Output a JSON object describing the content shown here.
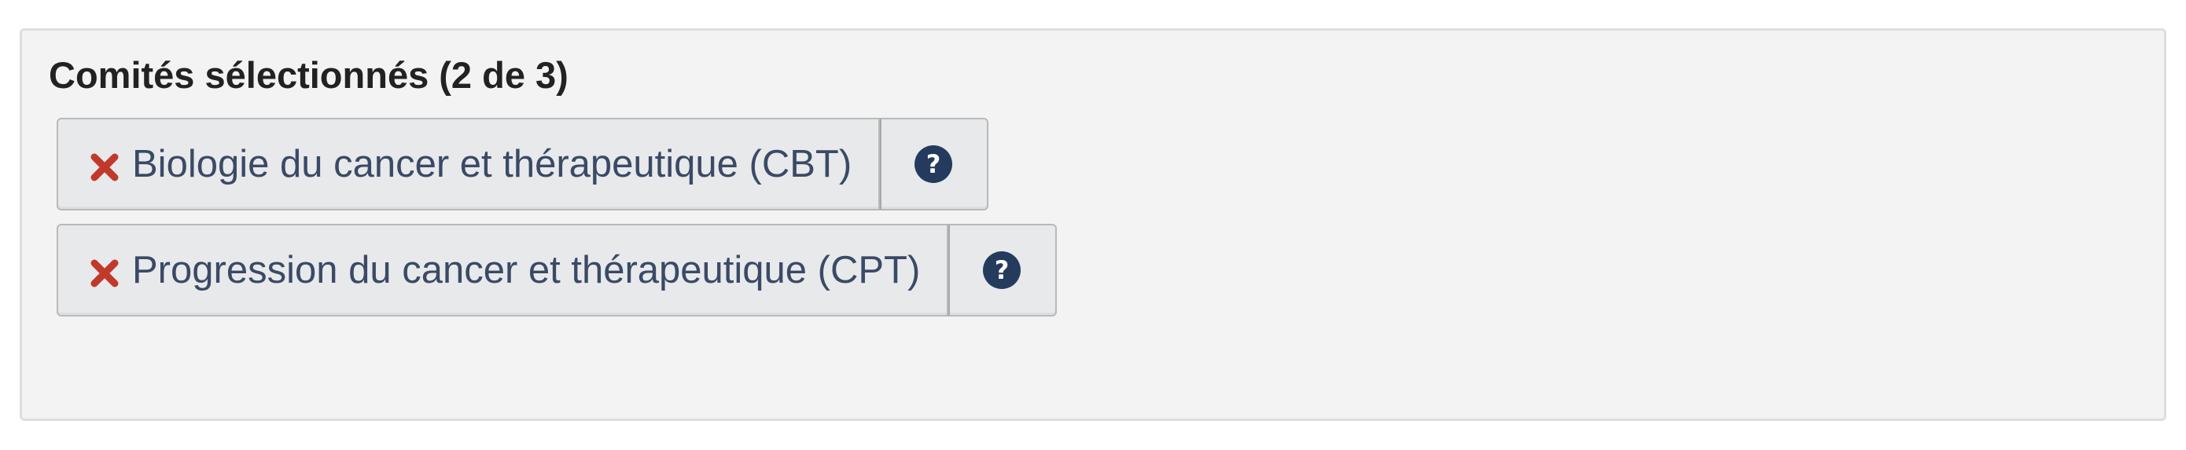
{
  "panel": {
    "title": "Comités sélectionnés (2 de 3)"
  },
  "selected_committees": [
    {
      "label": "Biologie du cancer et thérapeutique (CBT)",
      "remove_icon": "times-icon",
      "help_icon": "question-circle-icon"
    },
    {
      "label": "Progression du cancer et thérapeutique (CPT)",
      "remove_icon": "times-icon",
      "help_icon": "question-circle-icon"
    }
  ],
  "colors": {
    "panel_background": "#f3f3f3",
    "button_background": "#e8e9eb",
    "remove_icon": "#c0392b",
    "help_icon": "#243b5e",
    "label_text": "#3a4a66"
  }
}
